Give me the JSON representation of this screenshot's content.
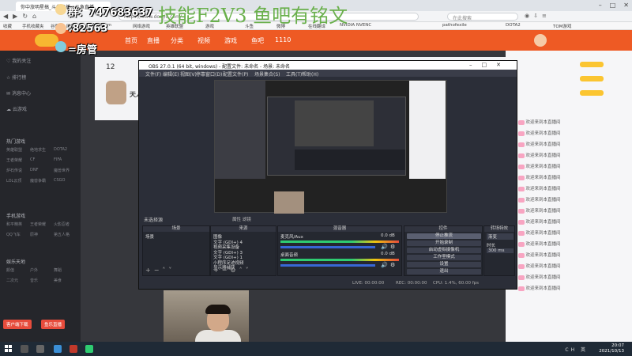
{
  "browser": {
    "tab_active": "你中旅明星搞_斗鱼直播 - 斗鱼直播",
    "address": "https://www.douyu.com/...",
    "search_placeholder": "在此搜索",
    "bookmarks": [
      "收藏",
      "手机收藏夹",
      "谷歌",
      "网址大全",
      "17173.com",
      "网络游戏",
      "英雄联盟",
      "游戏",
      "斗鱼",
      "微博",
      "在线翻译",
      "NVIDIA NVENC",
      "pathofexile",
      "DOTA2",
      "TOM游戏"
    ]
  },
  "overlay": {
    "qq_number": "群：747683637",
    "room_number": ":82563",
    "room_tag": "=房管",
    "green_text": "技能F2V3 鱼吧有铭文"
  },
  "site": {
    "nav": [
      "首页",
      "直播",
      "分类",
      "视频",
      "游戏",
      "鱼吧",
      "1110"
    ],
    "sidebar_items": [
      "我的关注",
      "排行榜",
      "消息中心",
      "云游戏"
    ],
    "section_hot": "热门游戏",
    "hot_games": [
      "英雄联盟",
      "绝地求生",
      "DOTA2",
      "王者荣耀",
      "CF",
      "FIFA",
      "炉石传说",
      "DNF",
      "魔兽世界",
      "LOL云顶",
      "魔兽争霸",
      "CSGO"
    ],
    "section_mobile": "手机游戏",
    "mobile_games": [
      "和平精英",
      "王者荣耀",
      "火影忍者",
      "QQ飞车",
      "原神",
      "第五人格"
    ],
    "section_ent": "娱乐天地",
    "ent_games": [
      "颜值",
      "户外",
      "舞蹈",
      "二次元",
      "音乐",
      "美食"
    ],
    "sb_btn1": "客户端下载",
    "sb_btn2": "鱼乐直播",
    "room_count": "12",
    "room_title": "天人"
  },
  "chat": {
    "lines": [
      "欢迎来到本直播间",
      "欢迎来到本直播间",
      "欢迎来到本直播间",
      "欢迎来到本直播间",
      "欢迎来到本直播间",
      "欢迎来到本直播间",
      "欢迎来到本直播间",
      "欢迎来到本直播间",
      "欢迎来到本直播间",
      "欢迎来到本直播间",
      "欢迎来到本直播间",
      "欢迎来到本直播间",
      "欢迎来到本直播间",
      "欢迎来到本直播间",
      "欢迎来到本直播间",
      "欢迎来到本直播间"
    ]
  },
  "obs": {
    "title": "OBS 27.0.1 (64 bit, windows) - 配置文件: 未命名 - 场景: 未命名",
    "menu": [
      "文件(F)",
      "编辑(E)",
      "视图(V)",
      "停靠窗口(D)",
      "配置文件(P)",
      "场景集合(S)",
      "工具(T)",
      "帮助(H)"
    ],
    "scene_label": "未选择源",
    "mode_label": "属性  滤镜",
    "docks": {
      "scenes": {
        "title": "场景",
        "items": [
          "场景"
        ]
      },
      "sources": {
        "title": "来源",
        "items": [
          "图像",
          "文字 (GDI+) 4",
          "视频采集设备",
          "文字 (GDI+) 3",
          "文字 (GDI+) 1",
          "小程序足迹视频",
          "显示器捕获"
        ]
      },
      "mixer": {
        "title": "混音器",
        "ch1": "麦克风/Aux",
        "ch1_db": "0.0 dB",
        "ch2": "桌面音频",
        "ch2_db": "0.0 dB"
      },
      "controls": {
        "title": "控件",
        "buttons": [
          "停止推流",
          "开始录制",
          "启动虚拟摄像机",
          "工作室模式",
          "设置",
          "退出"
        ]
      },
      "transition": {
        "title": "转场特效",
        "type": "渐变",
        "duration_label": "时长",
        "duration": "300 ms"
      }
    },
    "status": {
      "live": "LIVE: 00:00:00",
      "rec": "REC: 00:00:00",
      "cpu": "CPU: 1.4%, 60.00 fps"
    }
  },
  "taskbar": {
    "time": "20:07",
    "date": "2021/10/13",
    "lang": "CH 英"
  }
}
